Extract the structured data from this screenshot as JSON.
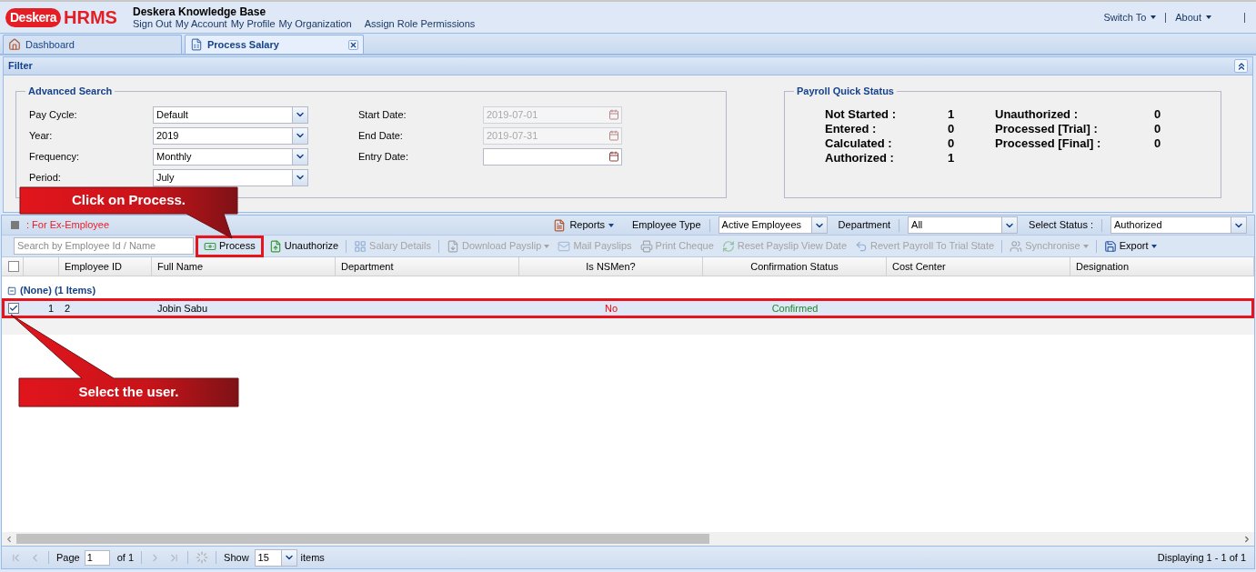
{
  "header": {
    "brand": "Deskera",
    "product": "HRMS",
    "title": "Deskera Knowledge Base",
    "links": [
      "Sign Out",
      "My Account",
      "My Profile",
      "My Organization",
      "Assign Role Permissions"
    ],
    "menus": [
      "Switch To",
      "About"
    ]
  },
  "tabs": [
    {
      "label": "Dashboard",
      "selected": false,
      "closable": false
    },
    {
      "label": "Process Salary",
      "selected": true,
      "closable": true
    }
  ],
  "filter": {
    "title": "Filter",
    "advanced_search": {
      "title": "Advanced Search",
      "combos": [
        {
          "label": "Pay Cycle:",
          "value": "Default"
        },
        {
          "label": "Year:",
          "value": "2019"
        },
        {
          "label": "Frequency:",
          "value": "Monthly"
        },
        {
          "label": "Period:",
          "value": "July"
        }
      ],
      "dates": [
        {
          "label": "Start Date:",
          "value": "2019-07-01",
          "disabled": true
        },
        {
          "label": "End Date:",
          "value": "2019-07-31",
          "disabled": true
        },
        {
          "label": "Entry Date:",
          "disabled": false
        }
      ]
    },
    "quick_status": {
      "title": "Payroll Quick Status",
      "columns": [
        [
          {
            "label": "Not Started :",
            "value": "1"
          },
          {
            "label": "Entered :",
            "value": "0"
          },
          {
            "label": "Calculated :",
            "value": "0"
          },
          {
            "label": "Authorized :",
            "value": "1"
          }
        ],
        [
          {
            "label": "Unauthorized :",
            "value": "0"
          },
          {
            "label": "Processed [Trial] :",
            "value": "0"
          },
          {
            "label": "Processed [Final] :",
            "value": "0"
          }
        ]
      ]
    }
  },
  "grid": {
    "legend": ": For Ex-Employee",
    "reports": "Reports",
    "filters": [
      {
        "label": "Employee Type",
        "value": "Active Employees"
      },
      {
        "label": "Department",
        "value": "All"
      },
      {
        "label": "Select Status :",
        "value": "Authorized"
      }
    ],
    "search": {
      "placeholder": "Search by Employee Id / Name"
    },
    "actions": [
      {
        "label": "Process",
        "disabled": false,
        "menu": false,
        "highlighted": true,
        "separator_before": false
      },
      {
        "label": "Unauthorize",
        "disabled": false,
        "menu": false,
        "highlighted": false,
        "separator_before": false
      },
      {
        "label": "Salary Details",
        "disabled": true,
        "menu": false,
        "highlighted": false,
        "separator_before": true
      },
      {
        "label": "Download Payslip",
        "disabled": true,
        "menu": true,
        "highlighted": false,
        "separator_before": true
      },
      {
        "label": "Mail Payslips",
        "disabled": true,
        "menu": false,
        "highlighted": false,
        "separator_before": false
      },
      {
        "label": "Print Cheque",
        "disabled": true,
        "menu": false,
        "highlighted": false,
        "separator_before": false
      },
      {
        "label": "Reset Payslip View Date",
        "disabled": true,
        "menu": false,
        "highlighted": false,
        "separator_before": false
      },
      {
        "label": "Revert Payroll To Trial State",
        "disabled": true,
        "menu": false,
        "highlighted": false,
        "separator_before": false
      },
      {
        "label": "Synchronise",
        "disabled": true,
        "menu": true,
        "highlighted": false,
        "separator_before": true
      },
      {
        "label": "Export",
        "disabled": false,
        "menu": true,
        "highlighted": false,
        "separator_before": true
      }
    ],
    "header_checked": false,
    "columns": [
      "Employee ID",
      "Full Name",
      "Department",
      "Is NSMen?",
      "Confirmation Status",
      "Cost Center",
      "Designation"
    ],
    "groups": [
      {
        "label": "(None) (1 Items)",
        "expanded": true,
        "rows": [
          {
            "number": "1",
            "selected": true,
            "highlighted": true,
            "employee_id": "2",
            "full_name": "Jobin Sabu",
            "is_nsmen": "No",
            "confirmation_status": "Confirmed"
          }
        ]
      }
    ],
    "paging": {
      "navigation_disabled": true,
      "page_label": "Page",
      "page": "1",
      "page_count": "of 1",
      "show_label": "Show",
      "page_size": "15",
      "items_label": "items",
      "summary": "Displaying 1 - 1 of 1"
    }
  },
  "annotations": [
    {
      "text": "Click on Process.",
      "kind": "down"
    },
    {
      "text": "Select the user.",
      "kind": "up"
    }
  ]
}
